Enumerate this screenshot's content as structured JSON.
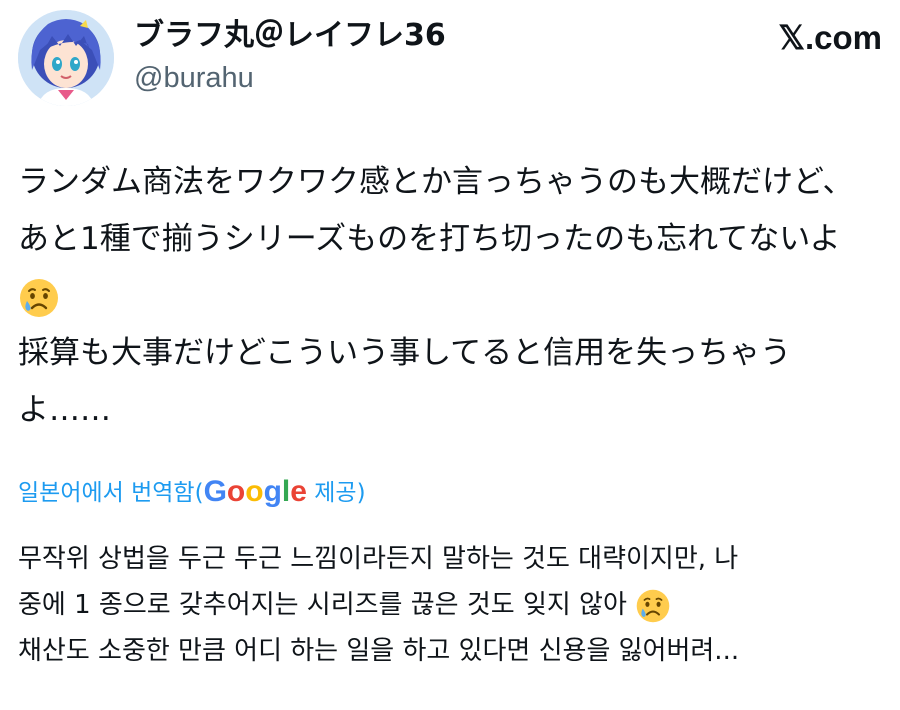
{
  "author": {
    "display_name": "ブラフ丸＠レイフレ36",
    "handle": "@burahu",
    "avatar_icon": "avatar-anime-character"
  },
  "brand": "𝕏.com",
  "tweet": {
    "lines": [
      "ランダム商法をワクワク感とか言っちゃうのも大概だけど、",
      "あと1種で揃うシリーズものを打ち切ったのも忘れてないよ",
      "採算も大事だけどこういう事してると信用を失っちゃう",
      "よ……"
    ],
    "emoji": "crying-face-emoji"
  },
  "translation": {
    "prefix": "일본어에서 번역함(",
    "provider": "Google",
    "suffix": " 제공)",
    "lines": [
      "무작위 상법을 두근 두근 느낌이라든지 말하는 것도 대략이지만, 나",
      "중에 1 종으로 갖추어지는 시리즈를 끊은 것도 잊지 않아",
      "채산도 소중한 만큼 어디 하는 일을 하고 있다면 신용을 잃어버려..."
    ]
  },
  "colors": {
    "text": "#0f1419",
    "secondary": "#536471",
    "link": "#1d9bf0",
    "emoji_face": "#ffcc4d",
    "emoji_tear": "#5dadec"
  }
}
